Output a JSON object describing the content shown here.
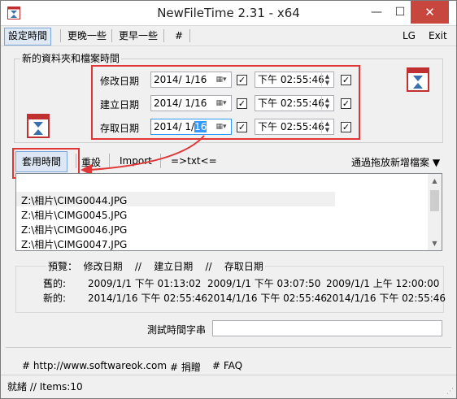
{
  "window": {
    "title": "NewFileTime 2.31 - x64",
    "close_glyph": "✕",
    "min_glyph": "—",
    "max_glyph": "☐"
  },
  "menu": {
    "set_time": "設定時間",
    "later": "更晚一些",
    "earlier": "更早一些",
    "hash": "#",
    "lg": "LG",
    "exit": "Exit"
  },
  "group": {
    "title": "新的資料夾和檔案時間"
  },
  "rows": [
    {
      "label": "修改日期",
      "date_year_month": "2014/ 1/16",
      "time": "下午 02:55:46",
      "date_checked": true,
      "time_checked": true
    },
    {
      "label": "建立日期",
      "date_year_month": "2014/ 1/16",
      "time": "下午 02:55:46",
      "date_checked": true,
      "time_checked": true
    },
    {
      "label": "存取日期",
      "date_prefix": "2014/ 1/",
      "date_selected": "16",
      "time": "下午 02:55:46",
      "date_checked": true,
      "time_checked": true
    }
  ],
  "actions": {
    "apply": "套用時間",
    "reset": "重設",
    "import": "Import",
    "txt": "=>txt<=",
    "drop": "通過拖放新增檔案 ▼"
  },
  "files": [
    "Z:\\相片\\CIMG0044.JPG",
    "Z:\\相片\\CIMG0045.JPG",
    "Z:\\相片\\CIMG0046.JPG",
    "Z:\\相片\\CIMG0047.JPG"
  ],
  "preview": {
    "header": "預覽：  修改日期    //    建立日期    //    存取日期",
    "old_label": "舊的:",
    "new_label": "新的:",
    "old": [
      "2009/1/1 下午 01:13:02",
      "2009/1/1 下午 03:07:50",
      "2009/1/1 上午 12:00:00"
    ],
    "new": [
      "2014/1/16 下午 02:55:46",
      "2014/1/16 下午 02:55:46",
      "2014/1/16 下午 02:55:46"
    ]
  },
  "test": {
    "label": "測試時間字串",
    "value": ""
  },
  "footer": {
    "website": "# http://www.softwareok.com",
    "donate": "# 捐贈",
    "faq": "# FAQ"
  },
  "status": {
    "text": "就緒 // Items:10"
  },
  "colors": {
    "highlight": "#e03636",
    "selection": "#3399ff",
    "close": "#c7463d"
  },
  "icons": {
    "app": "hourglass-icon",
    "group_left": "calendar-hourglass-icon",
    "group_right": "calendar-hourglass-icon"
  }
}
